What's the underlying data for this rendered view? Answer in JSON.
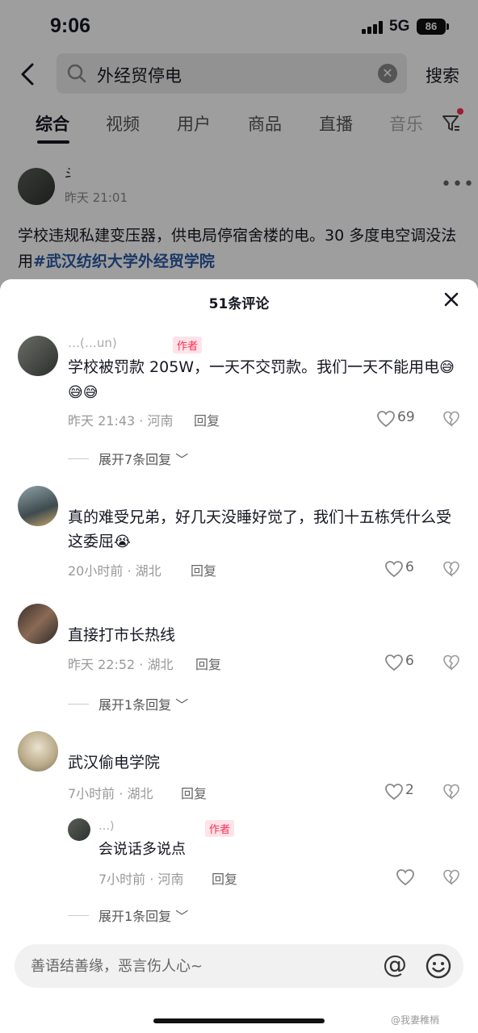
{
  "status": {
    "time": "9:06",
    "network": "5G",
    "battery": "86"
  },
  "search": {
    "query": "外经贸停电",
    "submit_label": "搜索"
  },
  "tabs": [
    {
      "label": "综合",
      "active": true
    },
    {
      "label": "视频"
    },
    {
      "label": "用户"
    },
    {
      "label": "商品"
    },
    {
      "label": "直播"
    },
    {
      "label": "音乐"
    }
  ],
  "post": {
    "author": "斗…",
    "time": "昨天 21:01",
    "text": "学校违规私建变压器，供电局停宿舍楼的电。30 多度电空调没法用",
    "hashtag": "#武汉纺织大学外经贸学院"
  },
  "sheet": {
    "title": "51条评论"
  },
  "comments": [
    {
      "name": "…(…un)",
      "author_tag": "作者",
      "text": "学校被罚款 205W，一天不交罚款。我们一天不能用电",
      "emojis": "😅😅😅",
      "time_location": "昨天 21:43 · 河南",
      "reply": "回复",
      "likes": "69",
      "expand": "展开7条回复"
    },
    {
      "name": "",
      "text": "真的难受兄弟，好几天没睡好觉了，我们十五栋凭什么受这委屈",
      "emojis": "😭",
      "time_location": "20小时前 · 湖北",
      "reply": "回复",
      "likes": "6"
    },
    {
      "name": "",
      "text": "直接打市长热线",
      "time_location": "昨天 22:52 · 湖北",
      "reply": "回复",
      "likes": "6",
      "expand": "展开1条回复"
    },
    {
      "name": "",
      "text": "武汉偷电学院",
      "time_location": "7小时前 · 湖北",
      "reply": "回复",
      "likes": "2",
      "sub_reply": {
        "name": "…)",
        "author_tag": "作者",
        "text": "会说话多说点",
        "time_location": "7小时前 · 河南",
        "reply": "回复"
      },
      "expand": "展开1条回复"
    }
  ],
  "input": {
    "placeholder": "善语结善缘，恶言伤人心~"
  },
  "watermark": "@我妻稚梢"
}
